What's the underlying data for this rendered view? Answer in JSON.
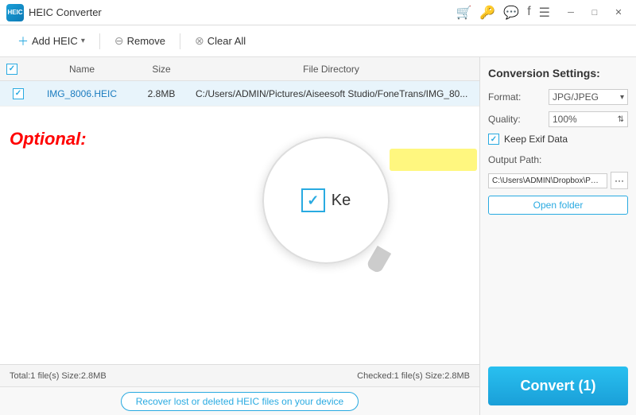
{
  "titlebar": {
    "logo_text": "HEIC",
    "title": "HEIC Converter",
    "nav_icons": [
      "cart",
      "key",
      "chat",
      "facebook",
      "menu"
    ],
    "win_controls": [
      "minimize",
      "maximize",
      "close"
    ]
  },
  "toolbar": {
    "add_label": "Add HEIC",
    "remove_label": "Remove",
    "clear_label": "Clear All"
  },
  "table": {
    "col_name": "Name",
    "col_size": "Size",
    "col_dir": "File Directory"
  },
  "files": [
    {
      "checked": true,
      "name": "IMG_8006.HEIC",
      "size": "2.8MB",
      "path": "C:/Users/ADMIN/Pictures/Aiseesoft Studio/FoneTrans/IMG_80..."
    }
  ],
  "magnifier": {
    "check_label": "Ke"
  },
  "optional_label": "Optional:",
  "panel": {
    "title": "Conversion Settings:",
    "format_label": "Format:",
    "format_value": "JPG/JPEG",
    "quality_label": "Quality:",
    "quality_value": "100%",
    "keep_exif_label": "Keep Exif Data",
    "keep_exif_checked": true,
    "output_path_label": "Output Path:",
    "output_path_value": "C:\\Users\\ADMIN\\Dropbox\\PC\\...",
    "open_folder_label": "Open folder",
    "convert_label": "Convert (1)"
  },
  "status": {
    "left": "Total:1 file(s)  Size:2.8MB",
    "right": "Checked:1 file(s)  Size:2.8MB"
  },
  "bottom": {
    "recover_label": "Recover lost or deleted HEIC files on your device"
  }
}
